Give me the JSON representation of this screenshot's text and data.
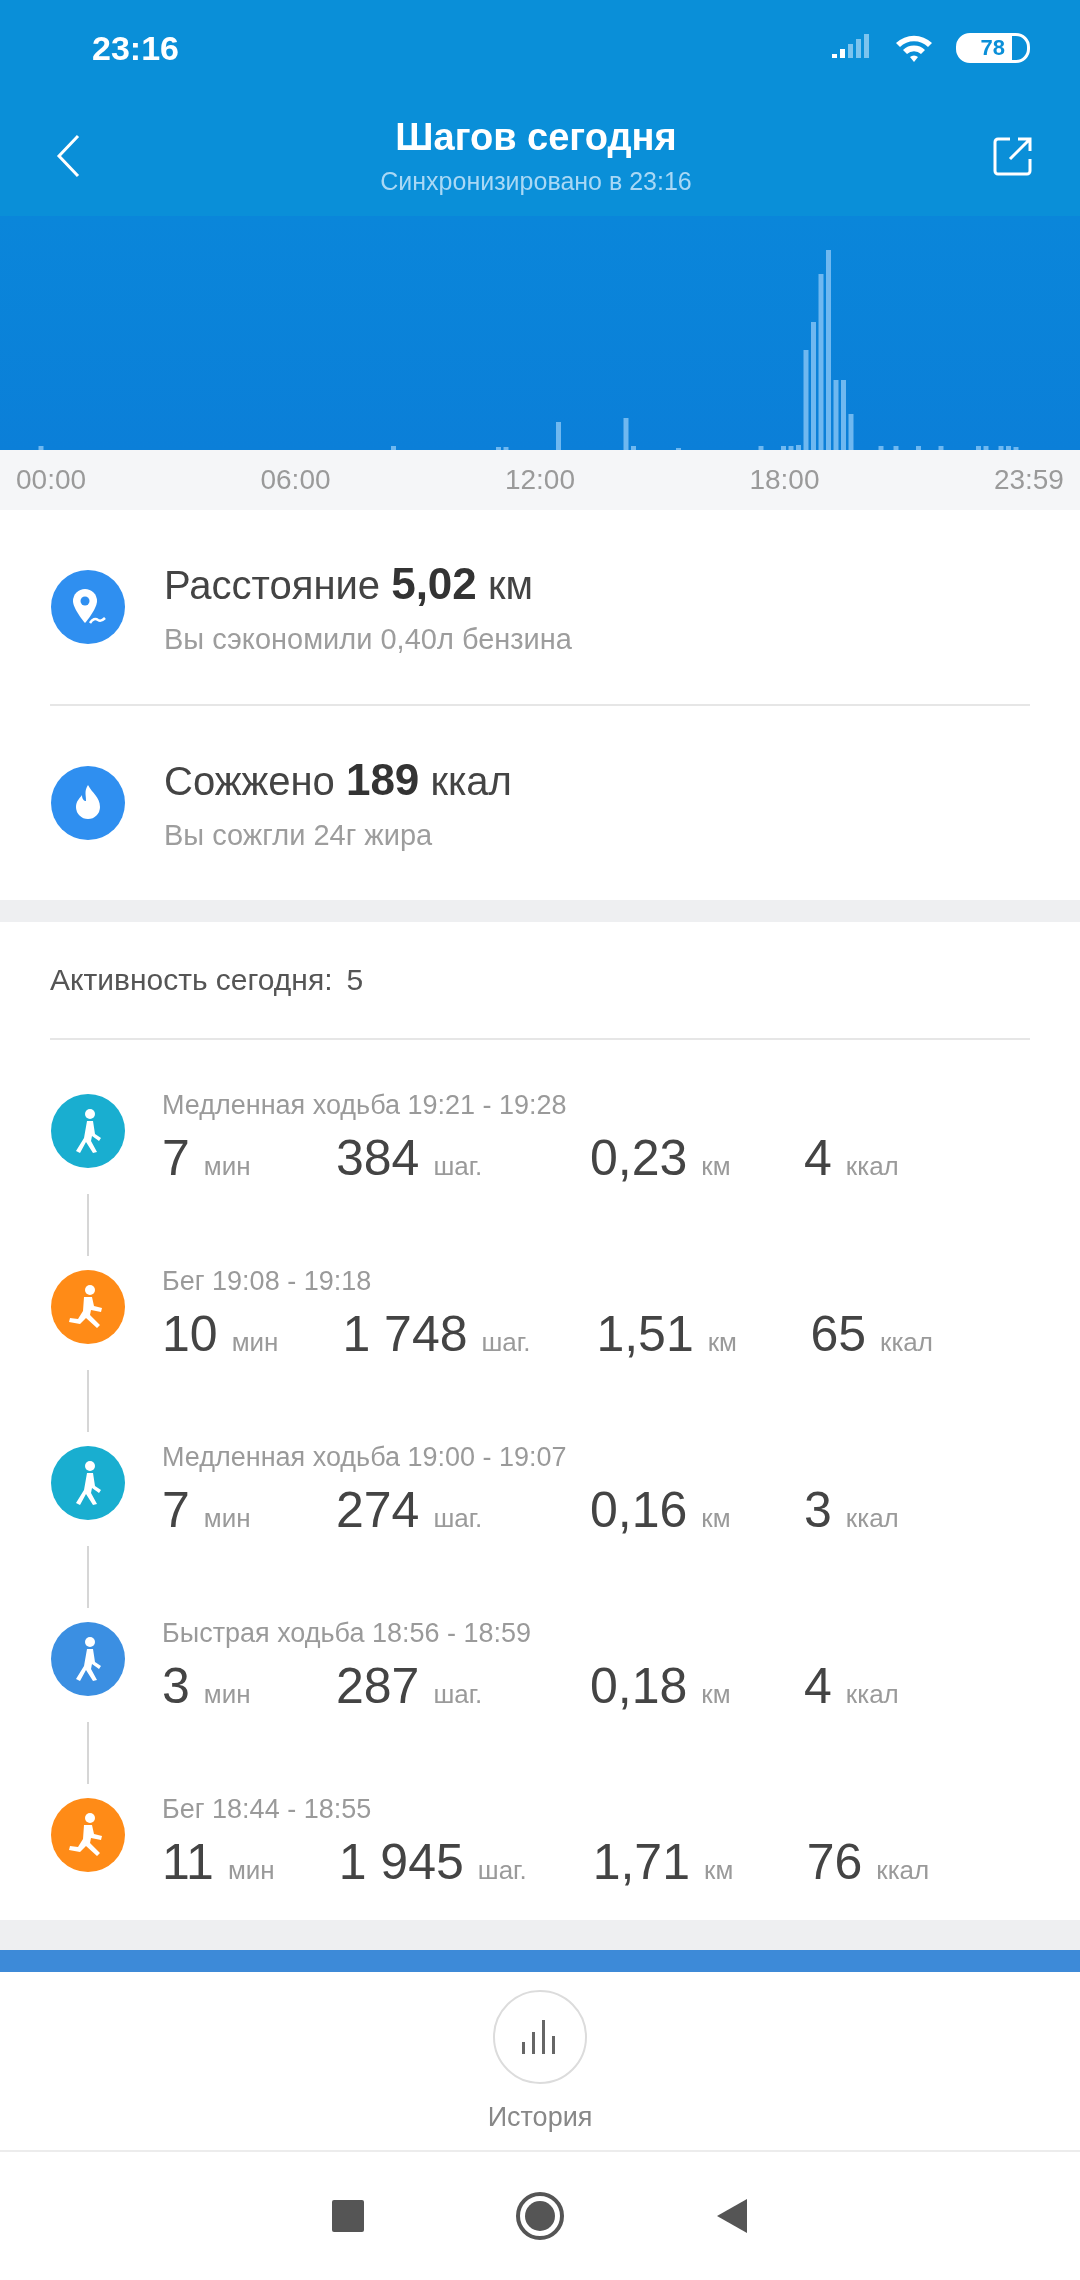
{
  "status_bar": {
    "time": "23:16",
    "battery": "78"
  },
  "header": {
    "title": "Шагов сегодня",
    "subtitle": "Синхронизировано в 23:16"
  },
  "chart": {
    "axis_labels": [
      "00:00",
      "06:00",
      "12:00",
      "18:00",
      "23:59"
    ]
  },
  "summary": [
    {
      "kind": "distance",
      "headline": "Расстояние **5,02** км",
      "note": "Вы сэкономили 0,40л бензина"
    },
    {
      "kind": "calories",
      "headline": "Сожжено **189** ккал",
      "note": "Вы сожгли 24г жира"
    }
  ],
  "activity": {
    "label": "Активность сегодня:",
    "count": "5"
  },
  "activities": [
    {
      "kind": "slow_walk",
      "title": "Медленная ходьба 19:21 - 19:28",
      "metrics": [
        {
          "value": "7",
          "unit": "мин"
        },
        {
          "value": "384",
          "unit": "шаг."
        },
        {
          "value": "0,23",
          "unit": "км"
        },
        {
          "value": "4",
          "unit": "ккал"
        }
      ]
    },
    {
      "kind": "run",
      "title": "Бег 19:08 - 19:18",
      "metrics": [
        {
          "value": "10",
          "unit": "мин"
        },
        {
          "value": "1 748",
          "unit": "шаг."
        },
        {
          "value": "1,51",
          "unit": "км"
        },
        {
          "value": "65",
          "unit": "ккал"
        }
      ]
    },
    {
      "kind": "slow_walk",
      "title": "Медленная ходьба 19:00 - 19:07",
      "metrics": [
        {
          "value": "7",
          "unit": "мин"
        },
        {
          "value": "274",
          "unit": "шаг."
        },
        {
          "value": "0,16",
          "unit": "км"
        },
        {
          "value": "3",
          "unit": "ккал"
        }
      ]
    },
    {
      "kind": "fast_walk",
      "title": "Быстрая ходьба 18:56 - 18:59",
      "metrics": [
        {
          "value": "3",
          "unit": "мин"
        },
        {
          "value": "287",
          "unit": "шаг."
        },
        {
          "value": "0,18",
          "unit": "км"
        },
        {
          "value": "4",
          "unit": "ккал"
        }
      ]
    },
    {
      "kind": "run",
      "title": "Бег 18:44 - 18:55",
      "metrics": [
        {
          "value": "11",
          "unit": "мин"
        },
        {
          "value": "1 945",
          "unit": "шаг."
        },
        {
          "value": "1,71",
          "unit": "км"
        },
        {
          "value": "76",
          "unit": "ккал"
        }
      ]
    }
  ],
  "bottom_nav": {
    "label": "История"
  }
}
